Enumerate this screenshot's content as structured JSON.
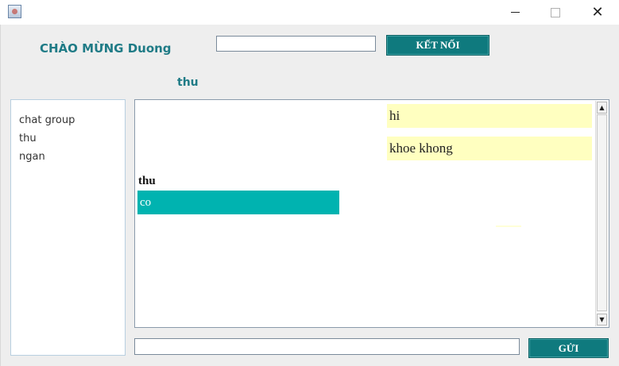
{
  "window": {
    "minimize_icon": "minimize-icon",
    "maximize_icon": "maximize-icon",
    "close_symbol": "✕"
  },
  "header": {
    "welcome": "CHÀO MỪNG Duong",
    "connect_input_value": "",
    "connect_button": "KẾT NỐI"
  },
  "current_chat": "thu",
  "users": [
    "chat group",
    "thu",
    "ngan"
  ],
  "messages": {
    "outgoing": [
      "hi",
      "khoe khong"
    ],
    "incoming_sender": "thu",
    "incoming": [
      "co"
    ]
  },
  "composer": {
    "value": "",
    "send_button": "GỬI"
  },
  "colors": {
    "accent": "#0f7a7e",
    "outgoing_bubble": "#ffffc0",
    "incoming_bubble": "#00b3b0",
    "heading_text": "#1f7b86"
  }
}
